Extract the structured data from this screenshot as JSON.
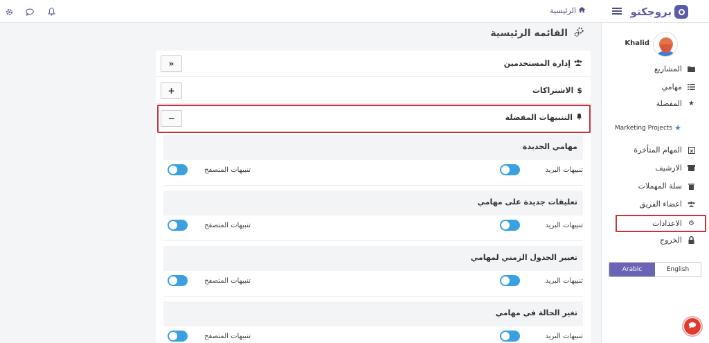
{
  "topbar": {
    "brand": "بروجكتو",
    "home_label": "الرئيسية"
  },
  "sidebar": {
    "username": "Khalid",
    "items": [
      {
        "label": "المشاريع",
        "icon": "folder-icon"
      },
      {
        "label": "مهامي",
        "icon": "list-icon"
      },
      {
        "label": "المفضلة",
        "icon": "star-icon"
      },
      {
        "label": "المهام المتأخرة",
        "icon": "calendar-x-icon"
      },
      {
        "label": "الارشيف",
        "icon": "archive-icon"
      },
      {
        "label": "سلة المهملات",
        "icon": "trash-icon"
      },
      {
        "label": "اعضاء الفريق",
        "icon": "users-icon"
      },
      {
        "label": "الاعدادات",
        "icon": "gear-icon"
      },
      {
        "label": "الخروج",
        "icon": "lock-icon"
      }
    ],
    "favorite_project": "Marketing Projects",
    "lang": {
      "english": "English",
      "arabic": "Arabic",
      "active": "Arabic"
    }
  },
  "main": {
    "title": "القائمه الرئيسية",
    "sections": [
      {
        "title": "إدارة المستخدمين",
        "button": "»",
        "icon": "users-icon"
      },
      {
        "title": "الاشتراكات",
        "button": "+",
        "icon": "dollar-icon"
      },
      {
        "title": "التنبيهات المفضلة",
        "button": "−",
        "icon": "bell-icon"
      }
    ],
    "preferences": [
      {
        "title": "مهامي الجديدة",
        "email_label": "تنبيهات البريد",
        "browser_label": "تنبيهات المتصفح",
        "email_on": true,
        "browser_on": true
      },
      {
        "title": "تعليقات جديدة على مهامي",
        "email_label": "تنبيهات البريد",
        "browser_label": "تنبيهات المتصفح",
        "email_on": true,
        "browser_on": true
      },
      {
        "title": "تغيير الجدول الزمني لمهامي",
        "email_label": "تنبيهات البريد",
        "browser_label": "تنبيهات المتصفح",
        "email_on": true,
        "browser_on": true
      },
      {
        "title": "تغير الحالة في مهامي",
        "email_label": "تنبيهات البريد",
        "browser_label": "تنبيهات المتصفح",
        "email_on": true,
        "browser_on": true
      }
    ]
  },
  "colors": {
    "accent": "#6b63b5",
    "toggle_on": "#3aa0e0",
    "highlight": "#c9323a"
  }
}
